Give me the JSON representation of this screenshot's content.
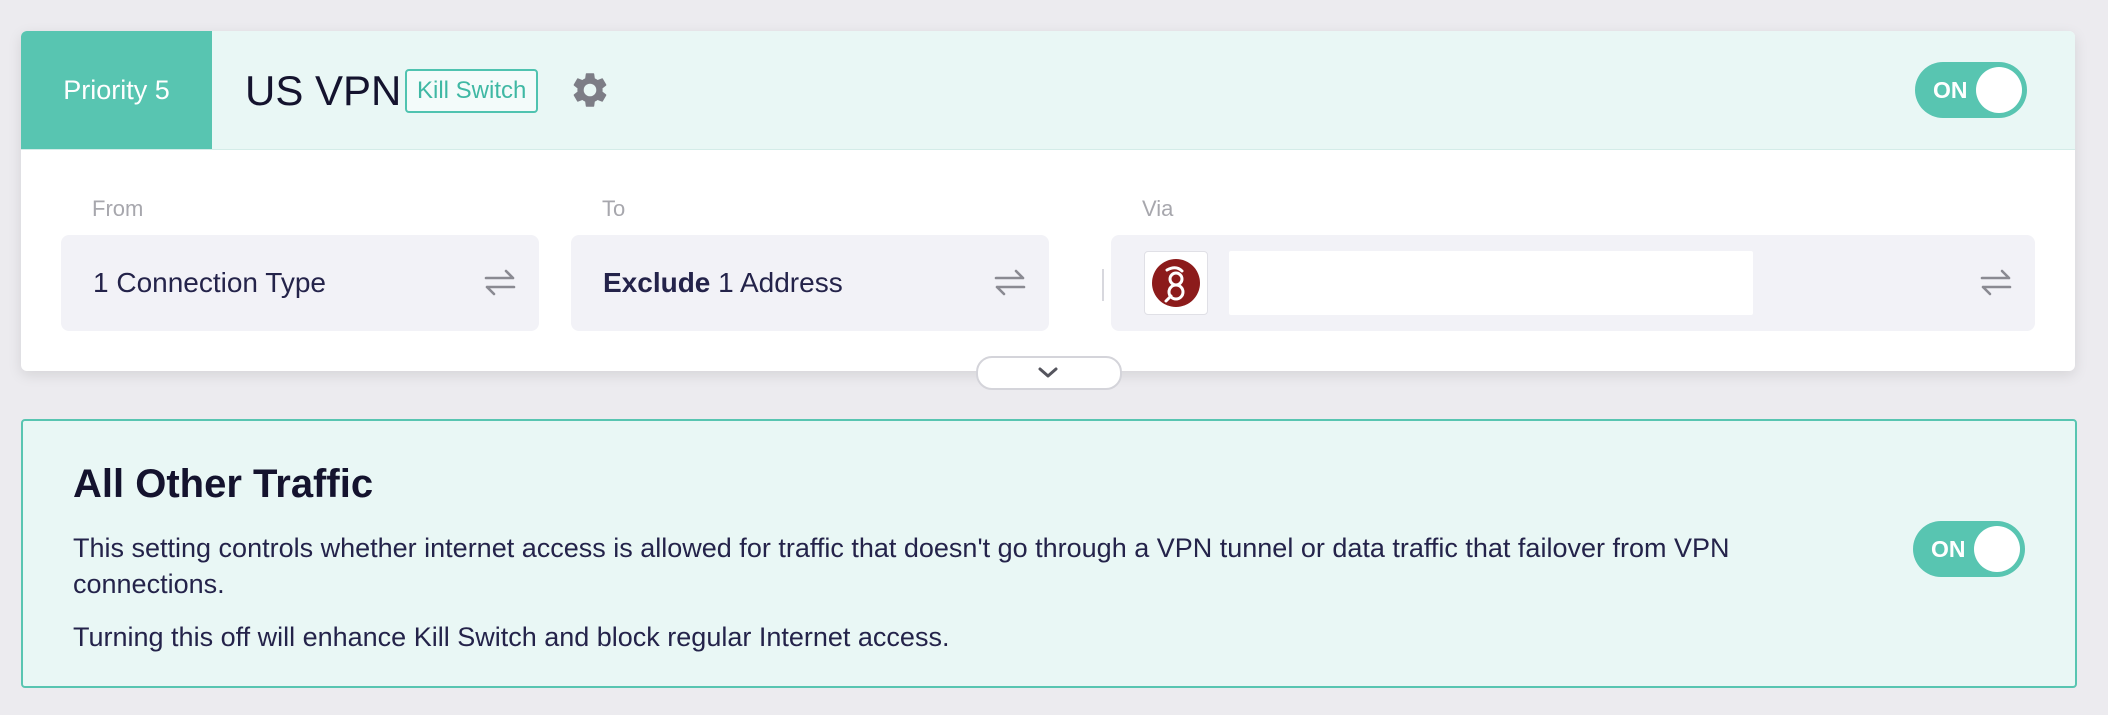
{
  "policy": {
    "priority_label": "Priority 5",
    "name": "US VPN",
    "kill_switch_badge": "Kill Switch",
    "gear_icon": "gear-icon",
    "toggle_label": "ON",
    "from": {
      "label": "From",
      "value": "1 Connection Type"
    },
    "to": {
      "label": "To",
      "value_bold": "Exclude",
      "value_rest": " 1 Address"
    },
    "via": {
      "label": "Via",
      "logo_icon": "wireguard-logo-icon"
    },
    "swap_icon": "swap-arrows-icon",
    "expand_icon": "chevron-down-icon",
    "colors": {
      "accent": "#58c5b1",
      "header_bg": "#e9f7f5",
      "logo_red": "#8c1b1b"
    }
  },
  "all_other_traffic": {
    "title": "All Other Traffic",
    "description": "This setting controls whether internet access is allowed for traffic that doesn't go through a VPN tunnel or data traffic that failover from VPN connections.",
    "note": "Turning this off will enhance Kill Switch and block regular Internet access.",
    "toggle_label": "ON"
  }
}
